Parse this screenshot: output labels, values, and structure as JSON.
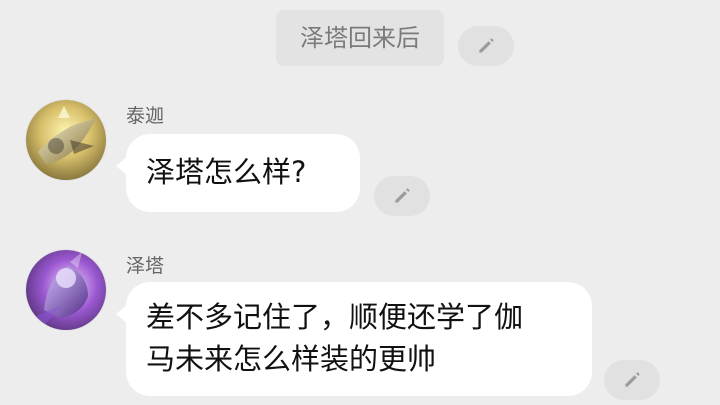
{
  "system_message": {
    "text": "泽塔回来后"
  },
  "messages": [
    {
      "sender": "泰迦",
      "text": "泽塔怎么样?"
    },
    {
      "sender": "泽塔",
      "lines": [
        "差不多记住了，顺便还学了伽",
        "马未来怎么样装的更帅"
      ]
    }
  ],
  "icons": {
    "edit": "pencil-icon",
    "avatar_1": "avatar-taiga",
    "avatar_2": "avatar-z"
  },
  "colors": {
    "background": "#ededed",
    "bubble": "#ffffff",
    "system_pill": "#e3e3e3",
    "edit_button": "#e1e1e1",
    "text_primary": "#111111",
    "text_secondary": "#666666"
  }
}
